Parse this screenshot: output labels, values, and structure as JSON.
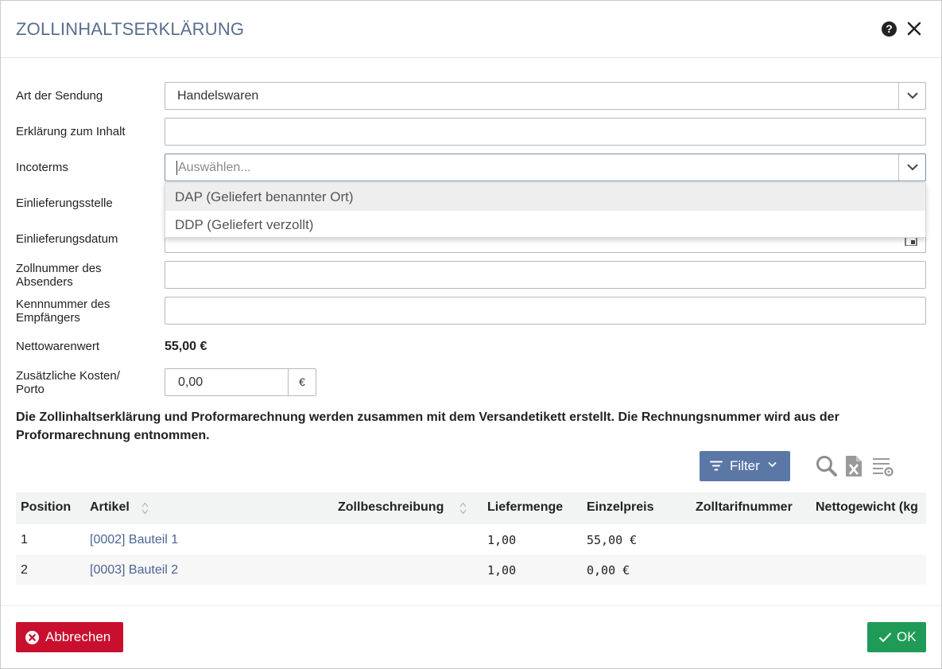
{
  "dialog": {
    "title": "ZOLLINHALTSERKLÄRUNG",
    "help_icon": "question-circle-icon",
    "close_icon": "close-icon"
  },
  "form": {
    "art_label": "Art der Sendung",
    "art_value": "Handelswaren",
    "erklaerung_label": "Erklärung zum Inhalt",
    "erklaerung_value": "",
    "incoterms_label": "Incoterms",
    "incoterms_placeholder": "Auswählen...",
    "incoterms_options": [
      "DAP (Geliefert benannter Ort)",
      "DDP (Geliefert verzollt)"
    ],
    "einlieferungsstelle_label": "Einlieferungsstelle",
    "einlieferungsdatum_label": "Einlieferungsdatum",
    "zollnummer_label": "Zollnummer des Absenders",
    "kennnummer_label": "Kennnummer des Empfängers",
    "nettowarenwert_label": "Nettowarenwert",
    "nettowarenwert_value": "55,00 €",
    "kosten_label": "Zusätzliche Kosten/ Porto",
    "kosten_value": "0,00",
    "kosten_unit": "€"
  },
  "notice": "Die Zollinhaltserklärung und Proformarechnung werden zusammen mit dem Versandetikett erstellt. Die Rechnungsnummer wird aus der Proformarechnung entnommen.",
  "toolbar": {
    "filter_label": "Filter",
    "icons": [
      "search-icon",
      "excel-export-icon",
      "column-settings-icon"
    ]
  },
  "table": {
    "columns": [
      "Position",
      "Artikel",
      "Zollbeschreibung",
      "Liefermenge",
      "Einzelpreis",
      "Zolltarifnummer",
      "Nettogewicht (kg"
    ],
    "rows": [
      {
        "position": "1",
        "artikel": "[0002] Bauteil 1",
        "zollbeschreibung": "",
        "liefermenge": "1,00",
        "einzelpreis": "55,00 €",
        "zolltarifnummer": "",
        "nettogewicht": ""
      },
      {
        "position": "2",
        "artikel": "[0003] Bauteil 2",
        "zollbeschreibung": "",
        "liefermenge": "1,00",
        "einzelpreis": "0,00 €",
        "zolltarifnummer": "",
        "nettogewicht": ""
      }
    ]
  },
  "footer": {
    "cancel_label": "Abbrechen",
    "ok_label": "OK"
  },
  "colors": {
    "title": "#5a6e8c",
    "filter_button": "#5b77a5",
    "cancel_button": "#c8102e",
    "ok_button": "#1f9b57",
    "link": "#4a6593"
  }
}
